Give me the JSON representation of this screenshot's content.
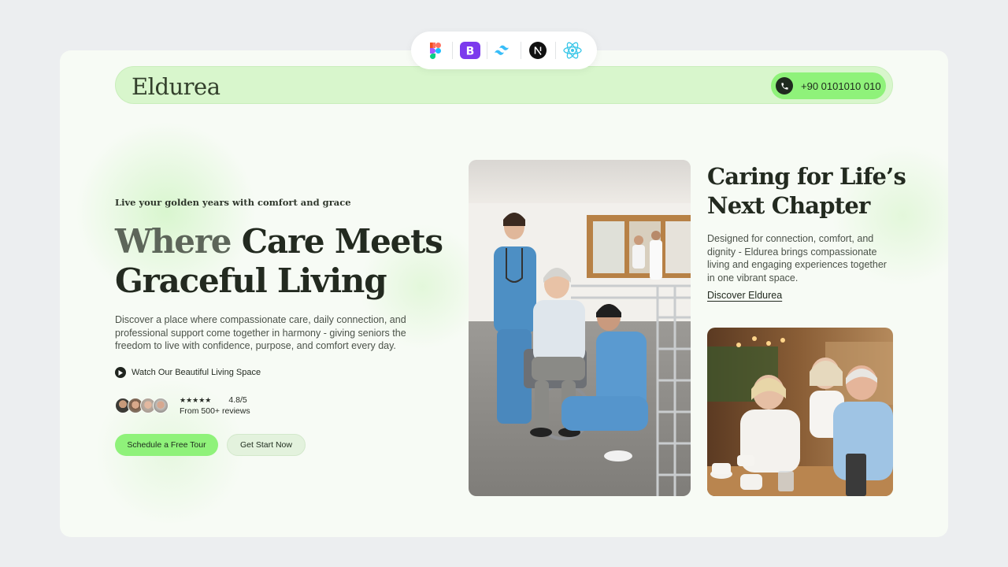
{
  "tech_badges": [
    "figma-icon",
    "bootstrap-icon",
    "tailwind-icon",
    "nextjs-icon",
    "react-icon"
  ],
  "header": {
    "logo": "Eldurea",
    "phone": "+90 0101010 010"
  },
  "hero": {
    "tagline": "Live your golden years with comfort and grace",
    "title_line1_soft": "Where",
    "title_line1_rest": " Care Meets",
    "title_line2": "Graceful Living",
    "description": "Discover a place where compassionate care, daily connection, and professional support come together in harmony - giving seniors the freedom to live with confidence, purpose, and comfort every day.",
    "watch_label": "Watch Our Beautiful Living Space",
    "stars": "★★★★★",
    "rating": "4.8/5",
    "reviews": "From 500+ reviews",
    "primary_cta": "Schedule a Free Tour",
    "secondary_cta": "Get Start Now"
  },
  "side": {
    "title": "Caring for Life’s Next Chapter",
    "description": "Designed for connection, comfort, and dignity - Eldurea brings compassionate living and engaging experiences together in one vibrant space.",
    "link": "Discover Eldurea"
  },
  "colors": {
    "accent_green": "#8ff27a",
    "nav_bg": "#d8f6cc",
    "text_dark": "#232a20",
    "card_bg": "#f7fbf5"
  }
}
